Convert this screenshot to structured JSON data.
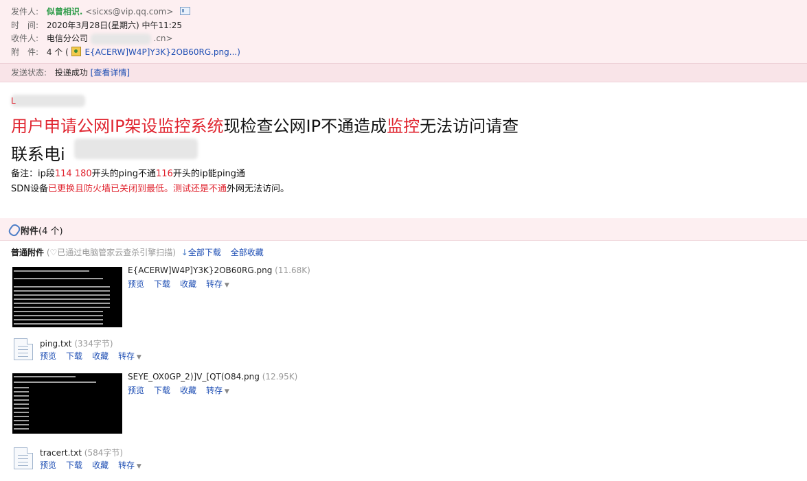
{
  "header": {
    "from_label": "发件人:",
    "sender_name": "似曾相识.",
    "sender_email": "<sicxs@vip.qq.com>",
    "time_label": "时　间:",
    "time_value": "2020年3月28日(星期六) 中午11:25",
    "to_label": "收件人:",
    "to_prefix": "电信分公司",
    "to_suffix": ".cn>",
    "att_label": "附　件:",
    "att_count": "4 个 (",
    "att_first": "E{ACERW]W4P]Y3K}2OB60RG.png...)"
  },
  "status": {
    "label": "发送状态:",
    "value": "投递成功",
    "detail": "[查看详情]"
  },
  "body": {
    "line1_red1": "用户申请公网IP架设监控系统",
    "line1_black1": "现检查公网IP不通造成",
    "line1_red2": "监控",
    "line1_black2": "无法访问请查",
    "line2": "联系电i",
    "note_a": "备注：ip段",
    "note_b": "114 180",
    "note_c": "开头的ping不通",
    "note_d": "116",
    "note_e": "开头的ip能ping通",
    "sdn_a": "SDN设备",
    "sdn_b": "已更换且防火墙已关闭到最低。测试还是不通",
    "sdn_c": "外网无法访问。"
  },
  "attachments_bar": {
    "title": "附件",
    "count": "(4 个)"
  },
  "normal": {
    "title": "普通附件",
    "scan": "(♡已通过电脑管家云查杀引擎扫描)",
    "download_all": "全部下载",
    "save_all": "全部收藏"
  },
  "files": [
    {
      "name": "E{ACERW]W4P]Y3K}2OB60RG.png",
      "size": "(11.68K)"
    },
    {
      "name": "ping.txt",
      "size": "(334字节)"
    },
    {
      "name": "SEYE_OX0GP_2)]V_[QT(O84.png",
      "size": "(12.95K)"
    },
    {
      "name": "tracert.txt",
      "size": "(584字节)"
    }
  ],
  "file_actions": {
    "preview": "预览",
    "download": "下载",
    "favorite": "收藏",
    "forward": "转存"
  },
  "colors": {
    "header_bg": "#fdeff1",
    "sender": "#2a9a46",
    "accent_red": "#e0242f",
    "link": "#1f4fb4"
  }
}
